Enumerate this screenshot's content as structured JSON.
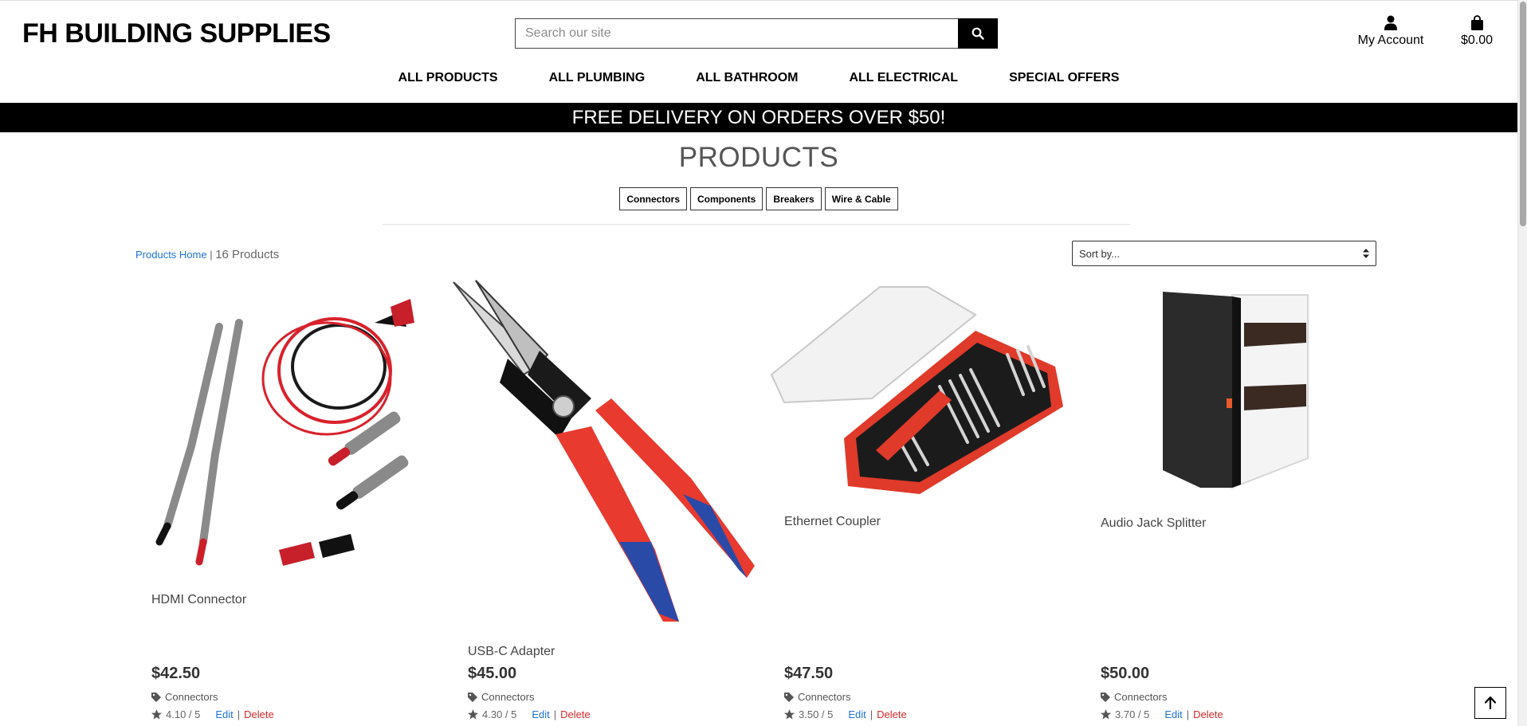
{
  "brand": "FH BUILDING SUPPLIES",
  "search": {
    "placeholder": "Search our site",
    "icon": "search-icon"
  },
  "account": {
    "label": "My Account"
  },
  "cart": {
    "total": "$0.00"
  },
  "nav": [
    "ALL PRODUCTS",
    "ALL PLUMBING",
    "ALL BATHROOM",
    "ALL ELECTRICAL",
    "SPECIAL OFFERS"
  ],
  "banner": "FREE DELIVERY ON ORDERS OVER $50!",
  "page_title": "PRODUCTS",
  "categories": [
    "Connectors",
    "Components",
    "Breakers",
    "Wire & Cable"
  ],
  "breadcrumb": {
    "home": "Products Home",
    "separator": " | ",
    "count": "16 Products"
  },
  "sort": {
    "label": "Sort by...",
    "icon": "sort-arrows-icon"
  },
  "products": [
    {
      "name": "HDMI Connector",
      "price": "$42.50",
      "category": "Connectors",
      "rating": "4.10 / 5",
      "edit": "Edit",
      "sep": "|",
      "delete": "Delete",
      "image": "test-leads-image"
    },
    {
      "name": "USB-C Adapter",
      "price": "$45.00",
      "category": "Connectors",
      "rating": "4.30 / 5",
      "edit": "Edit",
      "sep": "|",
      "delete": "Delete",
      "image": "pliers-image"
    },
    {
      "name": "Ethernet Coupler",
      "price": "$47.50",
      "category": "Connectors",
      "rating": "3.50 / 5",
      "edit": "Edit",
      "sep": "|",
      "delete": "Delete",
      "image": "screwdriver-set-image"
    },
    {
      "name": "Audio Jack Splitter",
      "price": "$50.00",
      "category": "Connectors",
      "rating": "3.70 / 5",
      "edit": "Edit",
      "sep": "|",
      "delete": "Delete",
      "image": "consumer-unit-image"
    }
  ],
  "colors": {
    "link": "#1e73d8",
    "delete": "#d6292b",
    "banner_bg": "#000000"
  }
}
